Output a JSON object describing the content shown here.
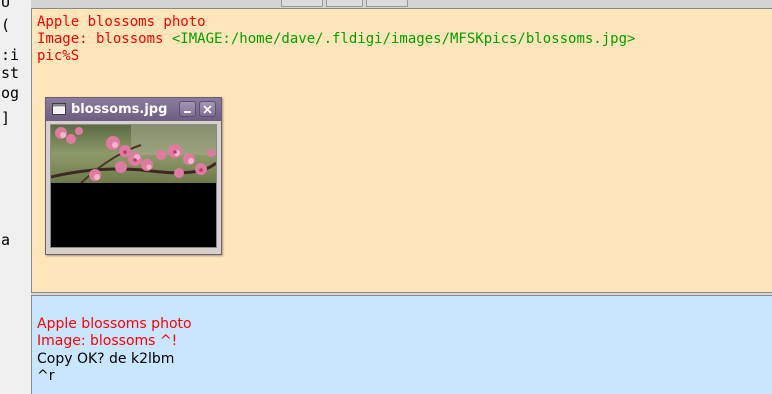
{
  "left_strip": {
    "chars": [
      "U",
      "(",
      ":i",
      "st",
      "og",
      "]",
      "a"
    ]
  },
  "rx": {
    "line1": "Apple blossoms photo",
    "line2_prefix": "Image: blossoms ",
    "line2_path": "<IMAGE:/home/dave/.fldigi/images/MFSKpics/blossoms.jpg>",
    "line3": "pic%S"
  },
  "tx": {
    "line1": "Apple blossoms photo",
    "line2": "Image: blossoms ^!",
    "line3": "Copy OK? de k2lbm",
    "line4": "^r"
  },
  "image_window": {
    "title": "blossoms.jpg",
    "icon": "window-icon",
    "minimize_icon": "minimize-icon",
    "close_icon": "close-icon"
  },
  "colors": {
    "rx_background": "#ffe6ba",
    "tx_background": "#c9e6ff",
    "rx_text_red": "#ff0000",
    "rx_text_green": "#00a000",
    "titlebar": "#6c5e82"
  }
}
